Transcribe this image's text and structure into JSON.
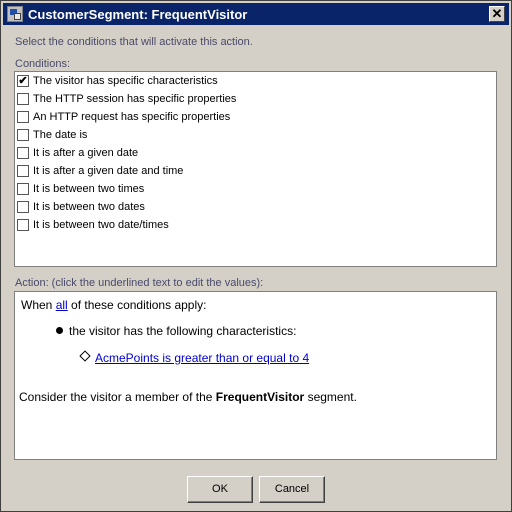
{
  "window": {
    "title": "CustomerSegment: FrequentVisitor",
    "close_glyph": "✕"
  },
  "instruction": "Select the conditions that will activate this action.",
  "conditions": {
    "label": "Conditions:",
    "items": [
      {
        "label": "The visitor has specific characteristics",
        "checked": true
      },
      {
        "label": "The HTTP session has specific properties",
        "checked": false
      },
      {
        "label": "An HTTP request has specific properties",
        "checked": false
      },
      {
        "label": "The date is",
        "checked": false
      },
      {
        "label": "It is after a given date",
        "checked": false
      },
      {
        "label": "It is after a given date and time",
        "checked": false
      },
      {
        "label": "It is between two times",
        "checked": false
      },
      {
        "label": "It is between two dates",
        "checked": false
      },
      {
        "label": "It is between two date/times",
        "checked": false
      }
    ]
  },
  "action": {
    "label": "Action: (click the underlined text to edit the values):",
    "when_prefix": "When ",
    "when_link": "all",
    "when_suffix": " of these conditions apply:",
    "bullet_text": "the visitor has the following characteristics:",
    "sub_link": "AcmePoints is greater than or equal to 4",
    "consider_prefix": "Consider the visitor a member of the ",
    "segment_name": "FrequentVisitor",
    "consider_suffix": " segment."
  },
  "buttons": {
    "ok": "OK",
    "cancel": "Cancel"
  }
}
